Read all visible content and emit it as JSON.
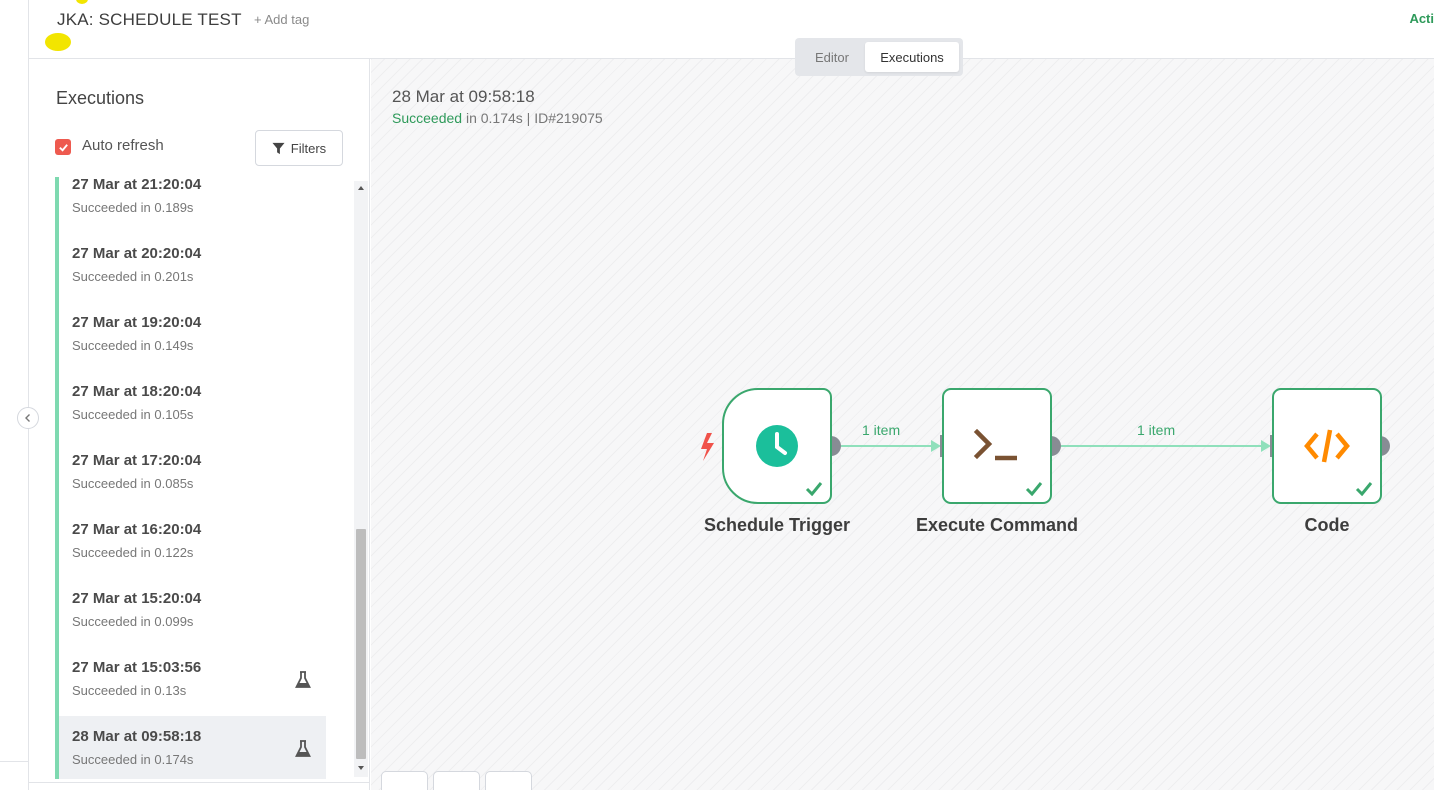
{
  "header": {
    "workflow_title": "JKA: SCHEDULE TEST",
    "add_tag_label": "+ Add tag",
    "active_label": "Acti"
  },
  "view_toggle": {
    "editor_label": "Editor",
    "executions_label": "Executions",
    "selected": "Executions"
  },
  "sidebar": {
    "title": "Executions",
    "auto_refresh_label": "Auto refresh",
    "auto_refresh_checked": true,
    "filters_label": "Filters",
    "items": [
      {
        "time": "27 Mar at 21:20:04",
        "status": "Succeeded in 0.189s",
        "test": false
      },
      {
        "time": "27 Mar at 20:20:04",
        "status": "Succeeded in 0.201s",
        "test": false
      },
      {
        "time": "27 Mar at 19:20:04",
        "status": "Succeeded in 0.149s",
        "test": false
      },
      {
        "time": "27 Mar at 18:20:04",
        "status": "Succeeded in 0.105s",
        "test": false
      },
      {
        "time": "27 Mar at 17:20:04",
        "status": "Succeeded in 0.085s",
        "test": false
      },
      {
        "time": "27 Mar at 16:20:04",
        "status": "Succeeded in 0.122s",
        "test": false
      },
      {
        "time": "27 Mar at 15:20:04",
        "status": "Succeeded in 0.099s",
        "test": false
      },
      {
        "time": "27 Mar at 15:03:56",
        "status": "Succeeded in 0.13s",
        "test": true
      },
      {
        "time": "28 Mar at 09:58:18",
        "status": "Succeeded in 0.174s",
        "test": true,
        "selected": true
      }
    ]
  },
  "execution": {
    "time": "28 Mar at 09:58:18",
    "status_word": "Succeeded",
    "status_rest": " in 0.174s | ID#219075"
  },
  "workflow": {
    "nodes": [
      {
        "name": "Schedule Trigger",
        "icon": "clock-icon"
      },
      {
        "name": "Execute Command",
        "icon": "terminal-icon"
      },
      {
        "name": "Code",
        "icon": "code-icon"
      }
    ],
    "edges": [
      {
        "label": "1 item"
      },
      {
        "label": "1 item"
      }
    ]
  },
  "colors": {
    "success": "#3aa76d",
    "edge": "#8fe0bb",
    "accent_red": "#ee5a4f",
    "code_orange": "#ff8a00",
    "terminal_brown": "#7a5232",
    "trigger_teal": "#1bbf9b"
  }
}
